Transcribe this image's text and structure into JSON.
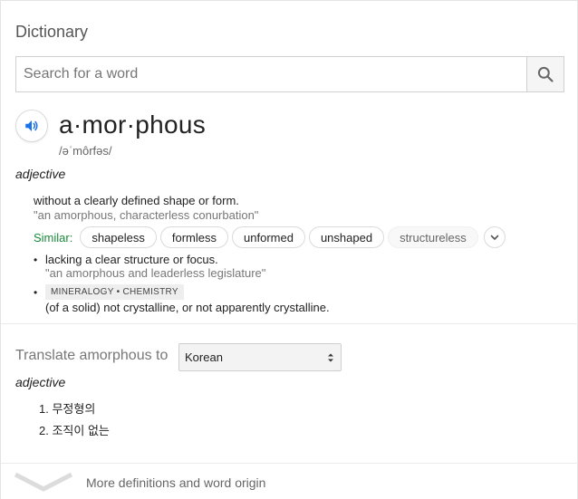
{
  "title": "Dictionary",
  "search": {
    "placeholder": "Search for a word",
    "value": ""
  },
  "entry": {
    "headword": "a·mor·phous",
    "phonetic": "/əˈmôrfəs/",
    "part_of_speech": "adjective",
    "definitions": [
      {
        "text": "without a clearly defined shape or form.",
        "example": "\"an amorphous, characterless conurbation\"",
        "similar_label": "Similar:",
        "similar": [
          "shapeless",
          "formless",
          "unformed",
          "unshaped",
          "structureless"
        ]
      },
      {
        "text": "lacking a clear structure or focus.",
        "example": "\"an amorphous and leaderless legislature\""
      },
      {
        "tag": "MINERALOGY • CHEMISTRY",
        "text": "(of a solid) not crystalline, or not apparently crystalline."
      }
    ]
  },
  "translate": {
    "label": "Translate amorphous to",
    "language": "Korean",
    "part_of_speech": "adjective",
    "items": [
      "1. 무정형의",
      "2. 조직이 없는"
    ]
  },
  "more": {
    "label": "More definitions and word origin"
  },
  "icons": {
    "search": "search-icon",
    "speaker": "speaker-icon",
    "expand": "chevron-down-icon",
    "select_arrows": "updown-arrows-icon",
    "more": "chevron-down-icon"
  },
  "colors": {
    "similar_label": "#1a8a3a",
    "speaker_blue": "#1a73e8"
  }
}
